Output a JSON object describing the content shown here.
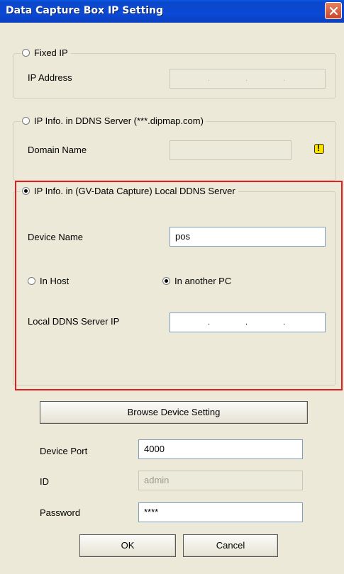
{
  "window": {
    "title": "Data Capture Box IP Setting"
  },
  "fixed_ip": {
    "radio_label": "Fixed IP",
    "ip_label": "IP Address",
    "ip_dots": [
      ".",
      ".",
      "."
    ]
  },
  "ddns": {
    "radio_label": "IP Info. in DDNS Server (***.dipmap.com)",
    "domain_label": "Domain Name",
    "domain_value": "",
    "warning_icon": "warning-icon"
  },
  "local_ddns": {
    "radio_label": "IP Info. in (GV-Data Capture) Local DDNS Server",
    "device_name_label": "Device Name",
    "device_name_value": "pos",
    "in_host_label": "In Host",
    "in_another_pc_label": "In another PC",
    "server_ip_label": "Local DDNS Server IP",
    "ip_dots": [
      ".",
      ".",
      "."
    ]
  },
  "browse_button": "Browse Device Setting",
  "device_port": {
    "label": "Device Port",
    "value": "4000"
  },
  "id": {
    "label": "ID",
    "value": "admin"
  },
  "password": {
    "label": "Password",
    "value": "****"
  },
  "ok_button": "OK",
  "cancel_button": "Cancel",
  "colors": {
    "title_bar": "#0b49d6",
    "highlight_border": "#e02020",
    "dialog_bg": "#ece9d8"
  }
}
